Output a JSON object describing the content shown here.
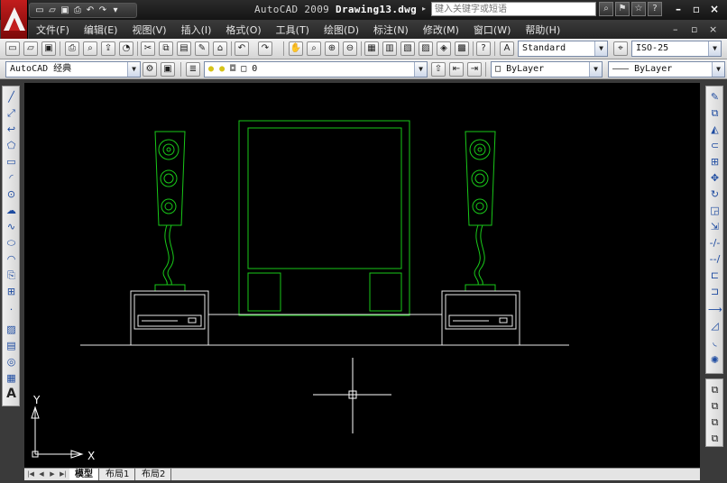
{
  "title": {
    "app_name": "AutoCAD 2009",
    "file_name": "Drawing13.dwg",
    "search_placeholder": "键入关键字或短语",
    "search_arrow": "▸"
  },
  "menu": {
    "items": [
      "文件(F)",
      "编辑(E)",
      "视图(V)",
      "插入(I)",
      "格式(O)",
      "工具(T)",
      "绘图(D)",
      "标注(N)",
      "修改(M)",
      "窗口(W)",
      "帮助(H)"
    ]
  },
  "toolbar": {
    "text_style": "Standard",
    "dim_style": "ISO-25",
    "workspace": "AutoCAD 经典",
    "layer": "0",
    "color": "ByLayer",
    "linetype": "ByLayer"
  },
  "canvas": {
    "background": "#000000",
    "line_color": "#19c819",
    "y_axis_label": "Y",
    "x_axis_label": "X"
  },
  "tabs": [
    "模型",
    "布局1",
    "布局2"
  ],
  "colors": {
    "brand": "#c21d1d",
    "chrome_dark": "#2b2b2b"
  }
}
